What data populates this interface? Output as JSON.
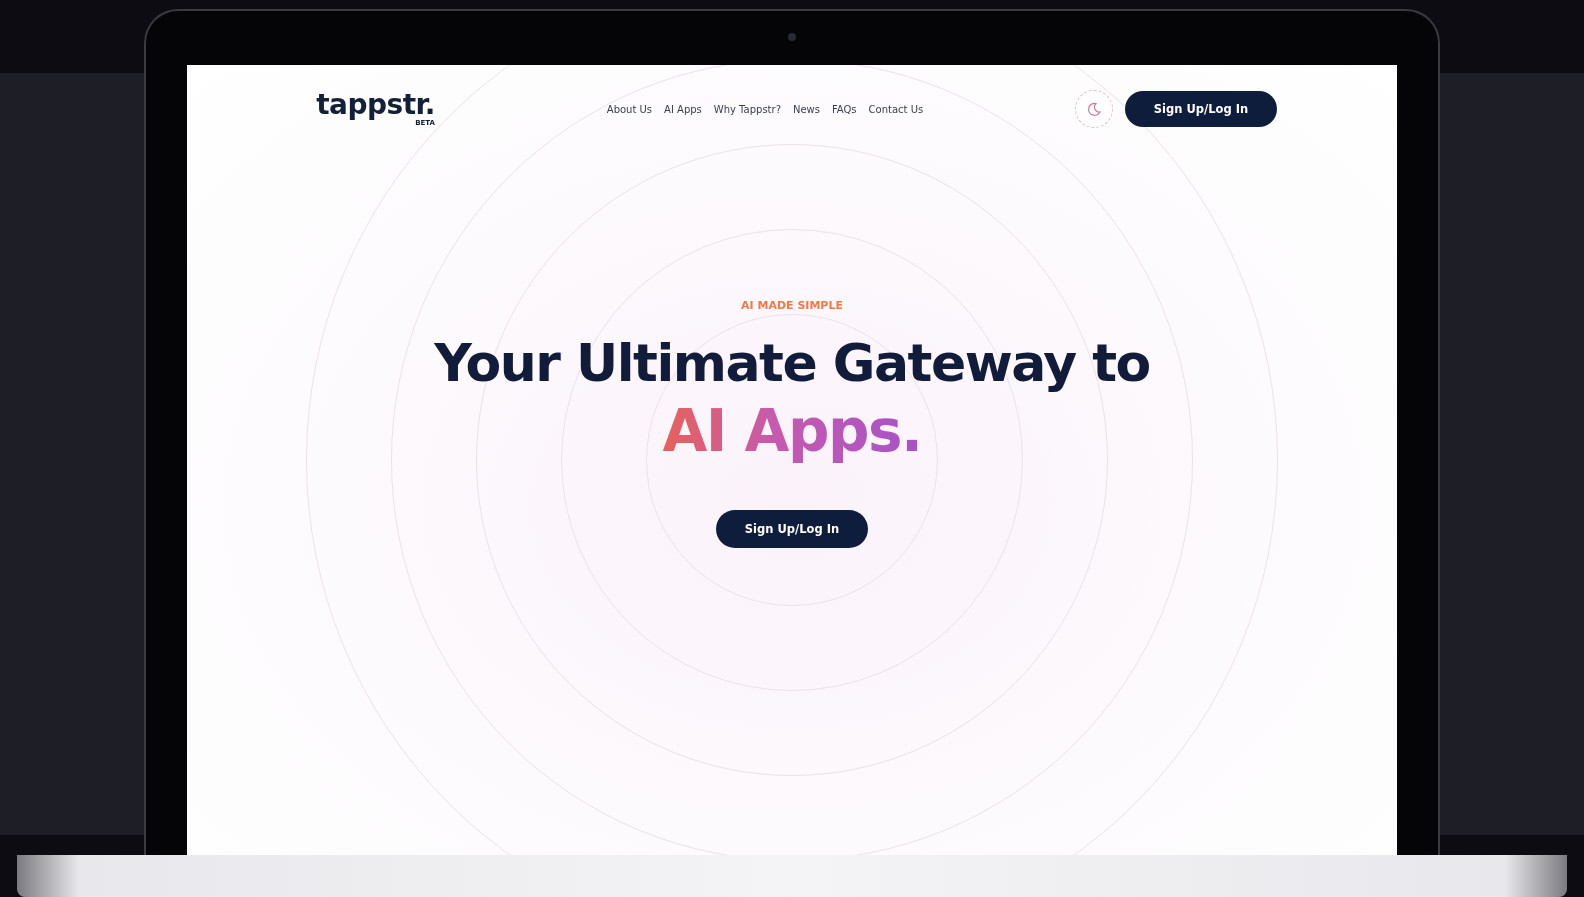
{
  "logo": {
    "wordmark": "tappstr.",
    "badge": "BETA"
  },
  "nav": {
    "links": [
      "About Us",
      "AI Apps",
      "Why Tappstr?",
      "News",
      "FAQs",
      "Contact Us"
    ],
    "button": "Sign Up/Log In"
  },
  "hero": {
    "eyebrow": "AI MADE SIMPLE",
    "headline": "Your Ultimate Gateway to",
    "highlight": "AI Apps.",
    "button": "Sign Up/Log In"
  }
}
